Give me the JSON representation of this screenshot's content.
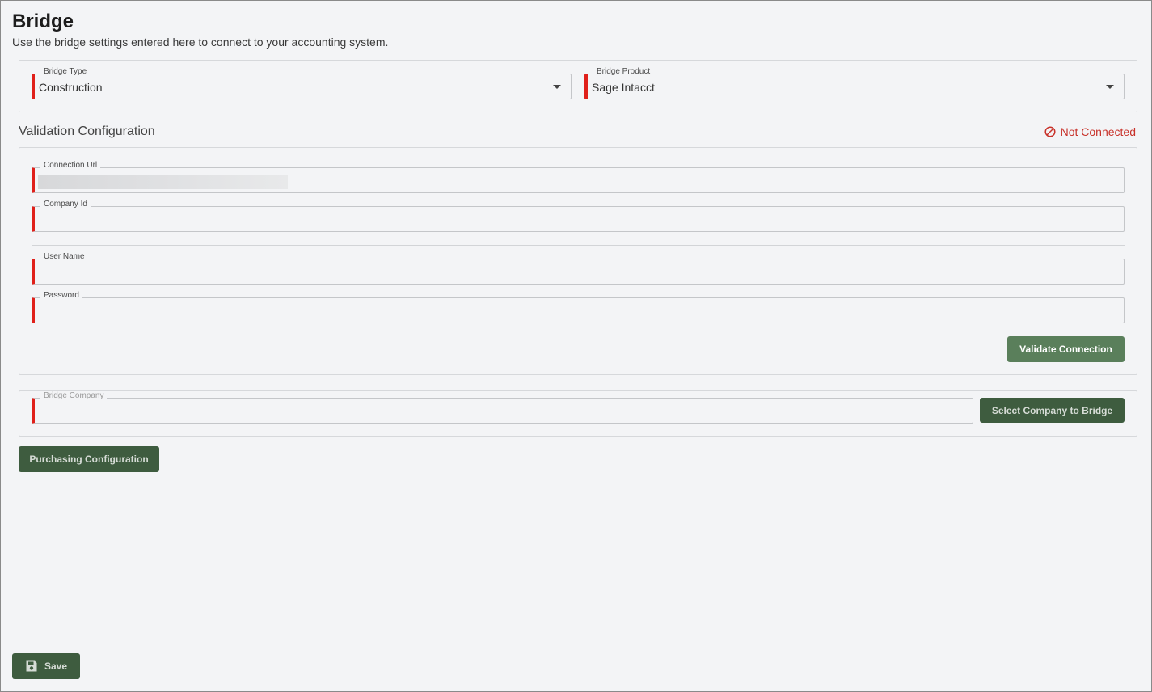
{
  "header": {
    "title": "Bridge",
    "subtitle": "Use the bridge settings entered here to connect to your accounting system."
  },
  "bridge_settings": {
    "bridge_type": {
      "label": "Bridge Type",
      "value": "Construction"
    },
    "bridge_product": {
      "label": "Bridge Product",
      "value": "Sage Intacct"
    }
  },
  "validation": {
    "heading": "Validation Configuration",
    "status_text": "Not Connected",
    "status_icon": "not-allowed-icon",
    "status_color": "#c8322a",
    "fields": {
      "connection_url": {
        "label": "Connection Url",
        "value": ""
      },
      "company_id": {
        "label": "Company Id",
        "value": ""
      },
      "user_name": {
        "label": "User Name",
        "value": ""
      },
      "password": {
        "label": "Password",
        "value": ""
      }
    },
    "validate_button": "Validate Connection"
  },
  "company": {
    "bridge_company": {
      "label": "Bridge Company",
      "value": ""
    },
    "select_button": "Select Company to Bridge"
  },
  "purchasing_button": "Purchasing Configuration",
  "footer": {
    "save_label": "Save",
    "save_icon": "floppy-disk-icon"
  },
  "colors": {
    "required_marker": "#e0201a",
    "button_primary": "#3e5c3f",
    "button_validate": "#5a7f5b"
  }
}
